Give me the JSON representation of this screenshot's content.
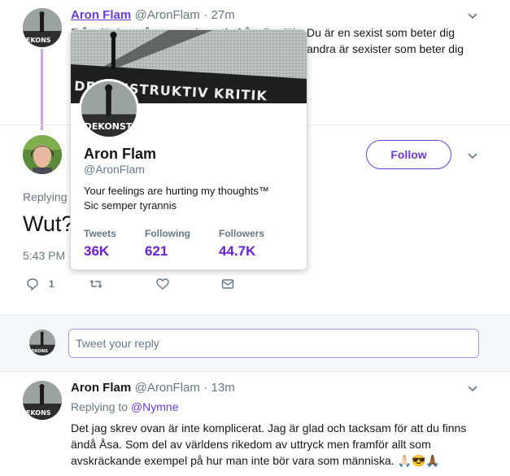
{
  "top_tweet": {
    "name": "Aron Flam",
    "handle": "@AronFlam",
    "time": "· 27m",
    "text_line1": "Från där jag står extrapolerar du från dig själv. Du är en sexist som beter dig",
    "text_line2": "andra är sexister som beter dig",
    "text_line2_prefix": ""
  },
  "main_tweet": {
    "follow_label": "Follow",
    "replying_label": "Replying",
    "body": "Wut?",
    "time": "5:43 PM ·",
    "reply_count": "1"
  },
  "hovercard": {
    "banner_text": "DEKONSTRUKTIV KRITIK",
    "avatar_text": "DEKONST",
    "name": "Aron Flam",
    "handle": "@AronFlam",
    "bio_line1": "Your feelings are hurting my thoughts™",
    "bio_line2": "Sic semper tyrannis",
    "stats": [
      {
        "label": "Tweets",
        "value": "36K"
      },
      {
        "label": "Following",
        "value": "621"
      },
      {
        "label": "Followers",
        "value": "44.7K"
      }
    ]
  },
  "reply_box": {
    "placeholder": "Tweet your reply"
  },
  "bottom_tweet": {
    "name": "Aron Flam",
    "handle": "@AronFlam",
    "time": "· 13m",
    "replying_prefix": "Replying to",
    "replying_to": "@Nymne",
    "line1": "Det jag skrev ovan är inte komplicerat. Jag är glad och tacksam för att du finns",
    "line2": "ändå Åsa. Som del av världens rikedom av uttryck men framför allt som",
    "line3": "avskräckande exempel på hur man inte bör vara som människa.",
    "emoji": "🙏🏻😎🙏🏾"
  },
  "colors": {
    "accent": "#6a3ad9",
    "stat_value": "#6a1fd1",
    "thread_line": "#c9a5f5",
    "link": "#1b6db8"
  }
}
